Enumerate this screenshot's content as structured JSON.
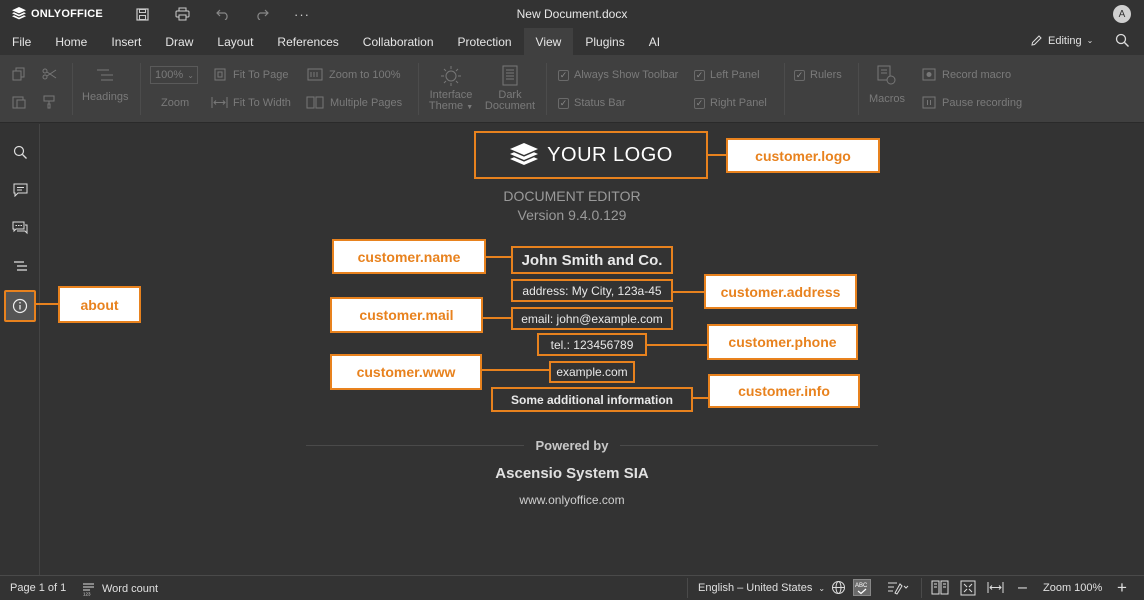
{
  "app": {
    "brand": "ONLYOFFICE",
    "document_title": "New Document.docx",
    "avatar_initial": "A",
    "mode_label": "Editing"
  },
  "menu": {
    "tabs": [
      "File",
      "Home",
      "Insert",
      "Draw",
      "Layout",
      "References",
      "Collaboration",
      "Protection",
      "View",
      "Plugins",
      "AI"
    ],
    "active_tab": "View"
  },
  "toolbar": {
    "headings": "Headings",
    "zoom_value": "100%",
    "zoom_label": "Zoom",
    "fit_to_page": "Fit To Page",
    "fit_to_width": "Fit To Width",
    "zoom_to_100": "Zoom to 100%",
    "multiple_pages": "Multiple Pages",
    "interface_theme_1": "Interface",
    "interface_theme_2": "Theme",
    "dark_document_1": "Dark",
    "dark_document_2": "Document",
    "always_show_toolbar": "Always Show Toolbar",
    "status_bar": "Status Bar",
    "left_panel": "Left Panel",
    "right_panel": "Right Panel",
    "rulers": "Rulers",
    "macros": "Macros",
    "record_macro": "Record macro",
    "pause_recording": "Pause recording"
  },
  "about": {
    "logo_text": "YOUR LOGO",
    "editor_name": "DOCUMENT EDITOR",
    "version": "Version 9.4.0.129",
    "customer_name": "John Smith and Co.",
    "address": "address: My City, 123a-45",
    "email": "email: john@example.com",
    "phone": "tel.: 123456789",
    "www": "example.com",
    "info": "Some additional information",
    "powered_by": "Powered by",
    "company": "Ascensio System SIA",
    "company_site": "www.onlyoffice.com"
  },
  "callouts": {
    "logo": "customer.logo",
    "name": "customer.name",
    "address": "customer.address",
    "mail": "customer.mail",
    "phone": "customer.phone",
    "www": "customer.www",
    "info": "customer.info",
    "about": "about"
  },
  "status": {
    "page": "Page 1 of 1",
    "word_count": "Word count",
    "language": "English – United States",
    "zoom": "Zoom 100%"
  },
  "colors": {
    "accent": "#e8821e",
    "background": "#333333",
    "toolbar": "#404040"
  }
}
